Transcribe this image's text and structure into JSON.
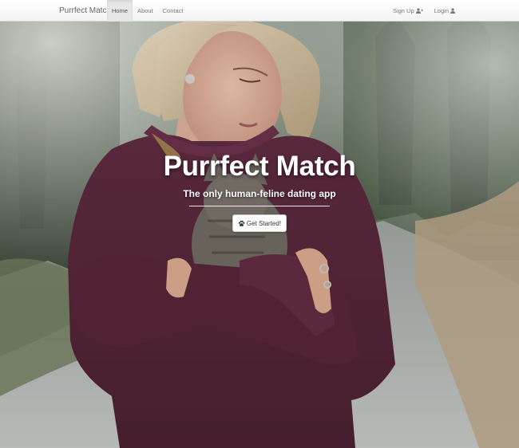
{
  "navbar": {
    "brand": "Purrfect Match",
    "links": [
      {
        "label": "Home",
        "active": true
      },
      {
        "label": "About",
        "active": false
      },
      {
        "label": "Contact",
        "active": false
      }
    ],
    "right_links": [
      {
        "label": "Sign Up",
        "icon": "user-plus-icon"
      },
      {
        "label": "Login",
        "icon": "user-icon"
      }
    ]
  },
  "hero": {
    "title": "Purrfect Match",
    "subtitle": "The only human-feline dating app",
    "cta_label": "Get Started!",
    "cta_icon": "paw-icon",
    "background_image": "photo of a woman in a plum sweater holding a tabby kitten on a forest path"
  },
  "colors": {
    "sweater": "#5b2a3d",
    "title_text": "#ffffff",
    "navbar_bg": "#f8f8f8"
  }
}
